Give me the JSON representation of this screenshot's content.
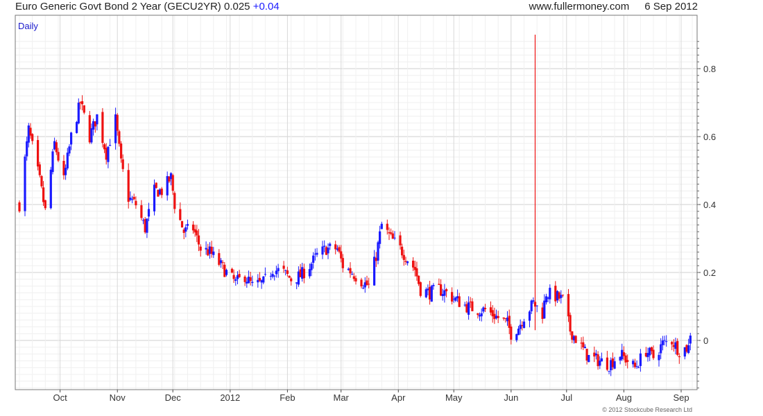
{
  "header": {
    "title": "Euro Generic Govt Bond 2 Year (GECU2YR)",
    "last": "0.025",
    "change": "+0.04",
    "site": "www.fullermoney.com",
    "date": "6 Sep 2012"
  },
  "footer": {
    "copyright": "© 2012 Stockcube Research Ltd"
  },
  "colors": {
    "up": "#1a1aff",
    "down": "#ee1111",
    "grid": "#d8d8d8",
    "axis": "#444444",
    "label_blue": "#1a1acc"
  },
  "chart_data": {
    "type": "candlestick",
    "period_label": "Daily",
    "title": "Euro Generic Govt Bond 2 Year (GECU2YR)",
    "ylim": [
      -0.15,
      0.92
    ],
    "y_ticks": [
      0,
      0.2,
      0.4,
      0.6,
      0.8
    ],
    "y_tick_labels": [
      "0",
      "0.2",
      "0.4",
      "0.6",
      "0.8"
    ],
    "x_tick_labels": [
      "Oct",
      "Nov",
      "Dec",
      "2012",
      "Feb",
      "Mar",
      "Apr",
      "May",
      "Jun",
      "Jul",
      "Aug",
      "Sep"
    ],
    "x_tick_dates": [
      "2011-10-01",
      "2011-11-01",
      "2011-12-01",
      "2012-01-01",
      "2012-02-01",
      "2012-03-01",
      "2012-04-01",
      "2012-05-01",
      "2012-06-01",
      "2012-07-01",
      "2012-08-01",
      "2012-09-01"
    ],
    "x_range": [
      "2011-09-09",
      "2012-09-07"
    ],
    "grid": true,
    "up_color": "blue",
    "down_color": "red",
    "approx_close_path": [
      {
        "date": "2011-09-09",
        "value": 0.4
      },
      {
        "date": "2011-09-14",
        "value": 0.62
      },
      {
        "date": "2011-09-20",
        "value": 0.47
      },
      {
        "date": "2011-09-23",
        "value": 0.38
      },
      {
        "date": "2011-09-28",
        "value": 0.58
      },
      {
        "date": "2011-10-03",
        "value": 0.47
      },
      {
        "date": "2011-10-07",
        "value": 0.6
      },
      {
        "date": "2011-10-12",
        "value": 0.7
      },
      {
        "date": "2011-10-17",
        "value": 0.6
      },
      {
        "date": "2011-10-21",
        "value": 0.66
      },
      {
        "date": "2011-10-26",
        "value": 0.55
      },
      {
        "date": "2011-10-31",
        "value": 0.65
      },
      {
        "date": "2011-11-03",
        "value": 0.52
      },
      {
        "date": "2011-11-07",
        "value": 0.42
      },
      {
        "date": "2011-11-11",
        "value": 0.4
      },
      {
        "date": "2011-11-16",
        "value": 0.33
      },
      {
        "date": "2011-11-21",
        "value": 0.44
      },
      {
        "date": "2011-11-25",
        "value": 0.44
      },
      {
        "date": "2011-11-30",
        "value": 0.48
      },
      {
        "date": "2011-12-02",
        "value": 0.4
      },
      {
        "date": "2011-12-07",
        "value": 0.32
      },
      {
        "date": "2011-12-12",
        "value": 0.33
      },
      {
        "date": "2011-12-16",
        "value": 0.27
      },
      {
        "date": "2011-12-21",
        "value": 0.26
      },
      {
        "date": "2011-12-27",
        "value": 0.22
      },
      {
        "date": "2011-12-30",
        "value": 0.2
      },
      {
        "date": "2012-01-04",
        "value": 0.17
      },
      {
        "date": "2012-01-09",
        "value": 0.19
      },
      {
        "date": "2012-01-13",
        "value": 0.16
      },
      {
        "date": "2012-01-19",
        "value": 0.17
      },
      {
        "date": "2012-01-24",
        "value": 0.21
      },
      {
        "date": "2012-01-30",
        "value": 0.2
      },
      {
        "date": "2012-02-03",
        "value": 0.18
      },
      {
        "date": "2012-02-08",
        "value": 0.19
      },
      {
        "date": "2012-02-13",
        "value": 0.22
      },
      {
        "date": "2012-02-17",
        "value": 0.25
      },
      {
        "date": "2012-02-22",
        "value": 0.27
      },
      {
        "date": "2012-02-28",
        "value": 0.27
      },
      {
        "date": "2012-03-02",
        "value": 0.22
      },
      {
        "date": "2012-03-07",
        "value": 0.2
      },
      {
        "date": "2012-03-13",
        "value": 0.17
      },
      {
        "date": "2012-03-16",
        "value": 0.16
      },
      {
        "date": "2012-03-20",
        "value": 0.25
      },
      {
        "date": "2012-03-23",
        "value": 0.34
      },
      {
        "date": "2012-03-28",
        "value": 0.3
      },
      {
        "date": "2012-04-02",
        "value": 0.27
      },
      {
        "date": "2012-04-06",
        "value": 0.24
      },
      {
        "date": "2012-04-10",
        "value": 0.21
      },
      {
        "date": "2012-04-13",
        "value": 0.15
      },
      {
        "date": "2012-04-18",
        "value": 0.14
      },
      {
        "date": "2012-04-23",
        "value": 0.15
      },
      {
        "date": "2012-04-27",
        "value": 0.14
      },
      {
        "date": "2012-05-02",
        "value": 0.12
      },
      {
        "date": "2012-05-08",
        "value": 0.1
      },
      {
        "date": "2012-05-14",
        "value": 0.09
      },
      {
        "date": "2012-05-18",
        "value": 0.09
      },
      {
        "date": "2012-05-24",
        "value": 0.07
      },
      {
        "date": "2012-05-30",
        "value": 0.05
      },
      {
        "date": "2012-06-01",
        "value": 0.02
      },
      {
        "date": "2012-06-05",
        "value": 0.04
      },
      {
        "date": "2012-06-08",
        "value": 0.07
      },
      {
        "date": "2012-06-13",
        "value": 0.11
      },
      {
        "date": "2012-06-18",
        "value": 0.08
      },
      {
        "date": "2012-06-20",
        "value": 0.14
      },
      {
        "date": "2012-06-25",
        "value": 0.13
      },
      {
        "date": "2012-06-29",
        "value": 0.12
      },
      {
        "date": "2012-07-03",
        "value": 0.03
      },
      {
        "date": "2012-07-09",
        "value": -0.02
      },
      {
        "date": "2012-07-13",
        "value": -0.05
      },
      {
        "date": "2012-07-19",
        "value": -0.06
      },
      {
        "date": "2012-07-24",
        "value": -0.07
      },
      {
        "date": "2012-07-30",
        "value": -0.04
      },
      {
        "date": "2012-08-03",
        "value": -0.06
      },
      {
        "date": "2012-08-07",
        "value": -0.08
      },
      {
        "date": "2012-08-13",
        "value": -0.03
      },
      {
        "date": "2012-08-17",
        "value": -0.05
      },
      {
        "date": "2012-08-22",
        "value": -0.01
      },
      {
        "date": "2012-08-27",
        "value": 0.0
      },
      {
        "date": "2012-08-31",
        "value": -0.03
      },
      {
        "date": "2012-09-05",
        "value": -0.02
      },
      {
        "date": "2012-09-06",
        "value": 0.025
      }
    ],
    "spike": {
      "date": "2012-06-14",
      "low": 0.03,
      "high": 0.9
    }
  }
}
